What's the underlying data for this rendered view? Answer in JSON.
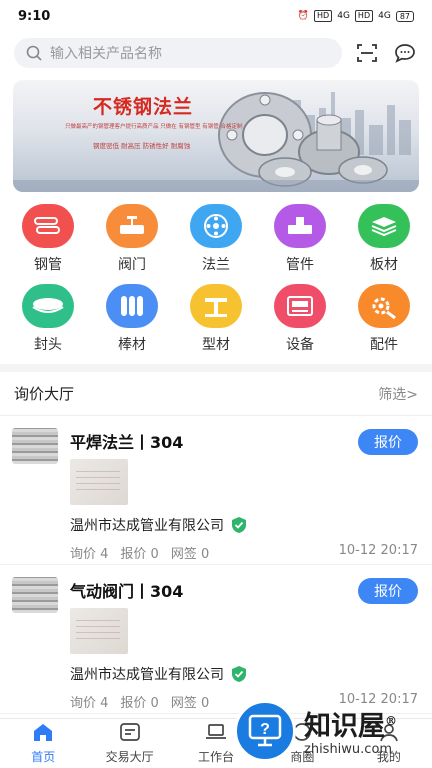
{
  "status_bar": {
    "time": "9:10",
    "hd1": "HD",
    "net1": "4G",
    "hd2": "HD",
    "net2": "4G",
    "battery": "87"
  },
  "search": {
    "placeholder": "输入相关产品名称"
  },
  "banner": {
    "title": "不锈钢法兰",
    "line1": "只做最高产的钢管理客户提行高质产品 只做在 有钢管型 有钢管 合格定制",
    "line2": "钢度密低 耐高压 防锈性好 耐腐蚀"
  },
  "categories": [
    {
      "label": "钢管",
      "icon": "pipe-icon",
      "color": "#f2504e"
    },
    {
      "label": "阀门",
      "icon": "valve-icon",
      "color": "#f78c3a"
    },
    {
      "label": "法兰",
      "icon": "flange-icon",
      "color": "#3fa6f2"
    },
    {
      "label": "管件",
      "icon": "pipe-fitting-icon",
      "color": "#b45ae6"
    },
    {
      "label": "板材",
      "icon": "plate-icon",
      "color": "#35c159"
    },
    {
      "label": "封头",
      "icon": "head-icon",
      "color": "#2fc08a"
    },
    {
      "label": "棒材",
      "icon": "bar-icon",
      "color": "#4b8ff5"
    },
    {
      "label": "型材",
      "icon": "profile-icon",
      "color": "#f6c230"
    },
    {
      "label": "设备",
      "icon": "equipment-icon",
      "color": "#f04d68"
    },
    {
      "label": "配件",
      "icon": "accessory-icon",
      "color": "#f98a2c"
    }
  ],
  "inquiry": {
    "title": "询价大厅",
    "filter": "筛选>",
    "items": [
      {
        "name": "平焊法兰丨304",
        "company": "温州市达成管业有限公司",
        "inquiry": "询价 4",
        "quote": "报价 0",
        "signed": "网签 0",
        "time": "10-12 20:17",
        "button": "报价"
      },
      {
        "name": "气动阀门丨304",
        "company": "温州市达成管业有限公司",
        "inquiry": "询价 4",
        "quote": "报价 0",
        "signed": "网签 0",
        "time": "10-12 20:17",
        "button": "报价"
      }
    ]
  },
  "tabs": [
    {
      "label": "首页",
      "icon": "home-icon"
    },
    {
      "label": "交易大厅",
      "icon": "list-icon"
    },
    {
      "label": "工作台",
      "icon": "laptop-icon"
    },
    {
      "label": "商圈",
      "icon": "circle-icon"
    },
    {
      "label": "我的",
      "icon": "user-icon"
    }
  ],
  "watermark": {
    "text": "知识屋",
    "mark": "®",
    "url": "zhishiwu.com"
  },
  "colors": {
    "accent": "#3d86f5",
    "verified": "#2fb46c"
  }
}
